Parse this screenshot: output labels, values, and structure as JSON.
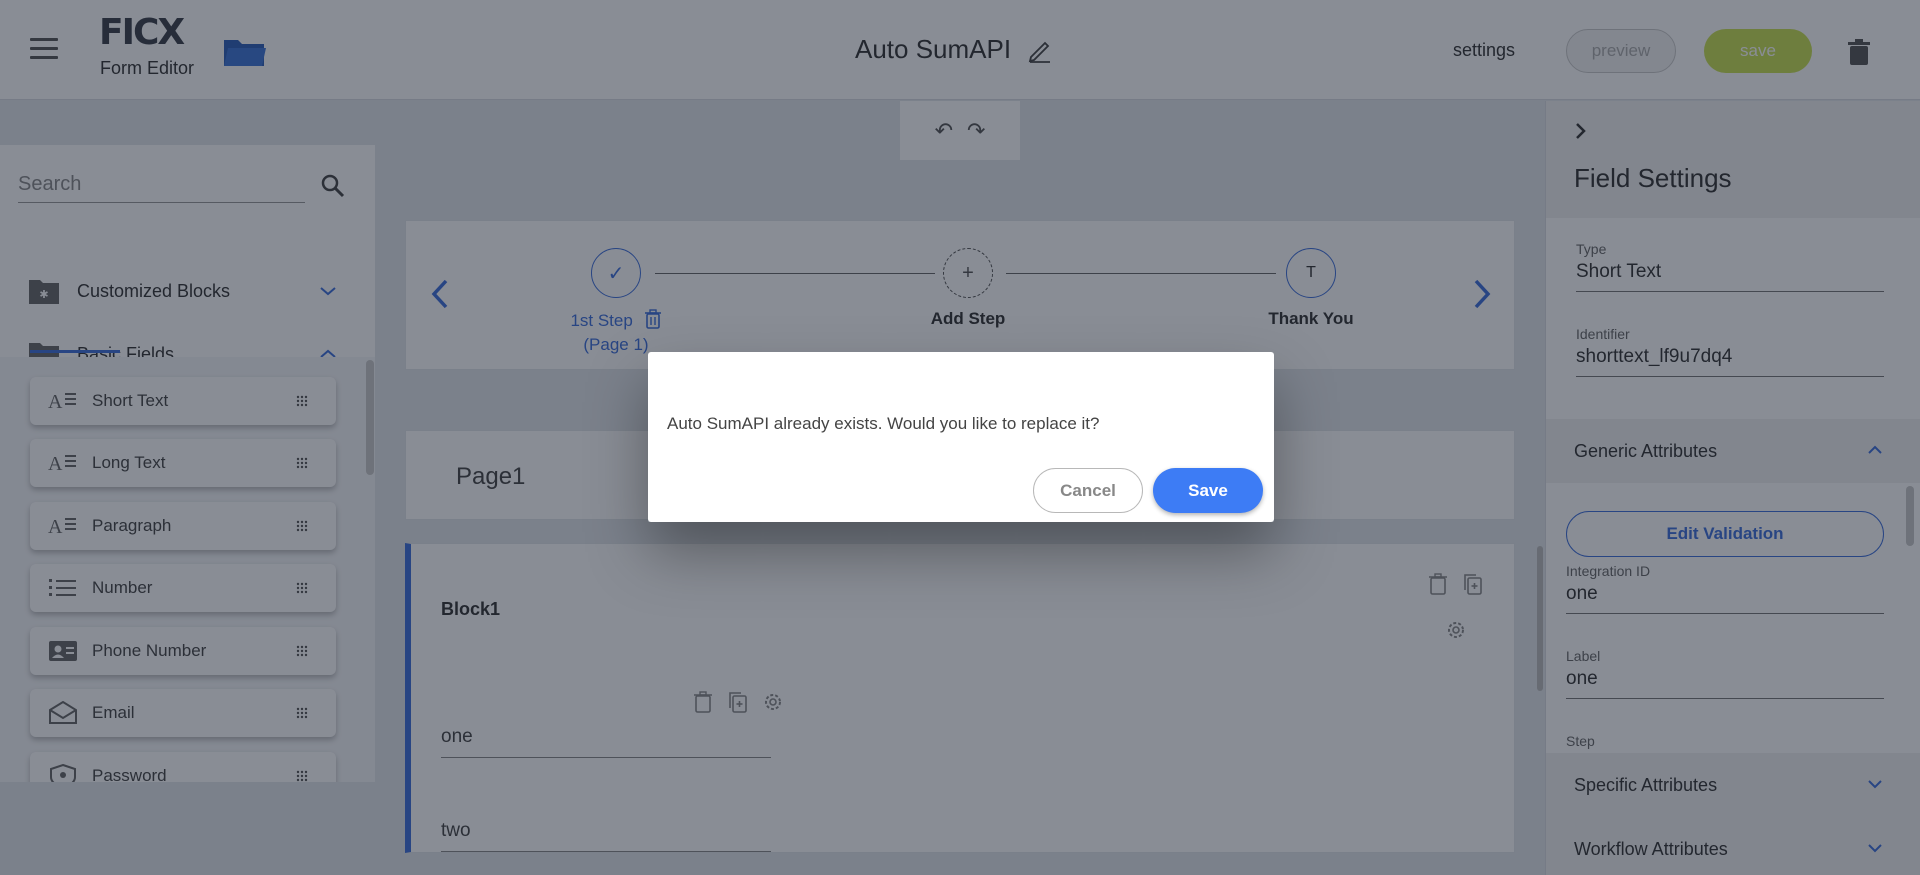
{
  "header": {
    "logo": "FICX",
    "logo_subtitle": "Form Editor",
    "form_title": "Auto SumAPI",
    "settings_label": "settings",
    "preview_label": "preview",
    "save_label": "save",
    "icons": [
      "menu-icon",
      "folder-open-icon",
      "pencil-icon",
      "trash-icon"
    ]
  },
  "toolbar": {
    "undo_icon": "undo-icon",
    "redo_icon": "redo-icon"
  },
  "sidebar": {
    "search": {
      "placeholder": "Search",
      "value": ""
    },
    "categories": [
      {
        "label": "Customized Blocks",
        "icon": "folder-star-icon",
        "expanded": false
      },
      {
        "label": "Basic Fields",
        "icon": "folder-icon",
        "expanded": true
      }
    ],
    "fields": [
      {
        "label": "Short Text",
        "icon": "text-icon"
      },
      {
        "label": "Long Text",
        "icon": "text-icon"
      },
      {
        "label": "Paragraph",
        "icon": "text-icon"
      },
      {
        "label": "Number",
        "icon": "list-number-icon"
      },
      {
        "label": "Phone Number",
        "icon": "contact-card-icon"
      },
      {
        "label": "Email",
        "icon": "envelope-icon"
      },
      {
        "label": "Password",
        "icon": "badge-icon"
      }
    ]
  },
  "steps": {
    "items": [
      {
        "label": "1st Step",
        "sublabel": "(Page 1)",
        "marker": "✓"
      },
      {
        "label": "Add Step",
        "marker": "+"
      },
      {
        "label": "Thank You",
        "marker": "T"
      }
    ]
  },
  "page": {
    "title": "Page1"
  },
  "block": {
    "title": "Block1",
    "fields": [
      {
        "value": "one"
      },
      {
        "value": "two"
      }
    ]
  },
  "field_settings": {
    "title": "Field Settings",
    "type_label": "Type",
    "type_value": "Short Text",
    "identifier_label": "Identifier",
    "identifier_value": "shorttext_lf9u7dq4",
    "generic_label": "Generic Attributes",
    "edit_validation_label": "Edit Validation",
    "integration_id_label": "Integration ID",
    "integration_id_value": "one",
    "label_label": "Label",
    "label_value": "one",
    "step_label": "Step",
    "specific_label": "Specific Attributes",
    "workflow_label": "Workflow Attributes"
  },
  "dialog": {
    "message": "Auto SumAPI already exists. Would you like to replace it?",
    "cancel_label": "Cancel",
    "save_label": "Save"
  },
  "colors": {
    "accent": "#3d6edb",
    "save_green": "#c8e051",
    "dialog_save": "#3d7cf5"
  }
}
